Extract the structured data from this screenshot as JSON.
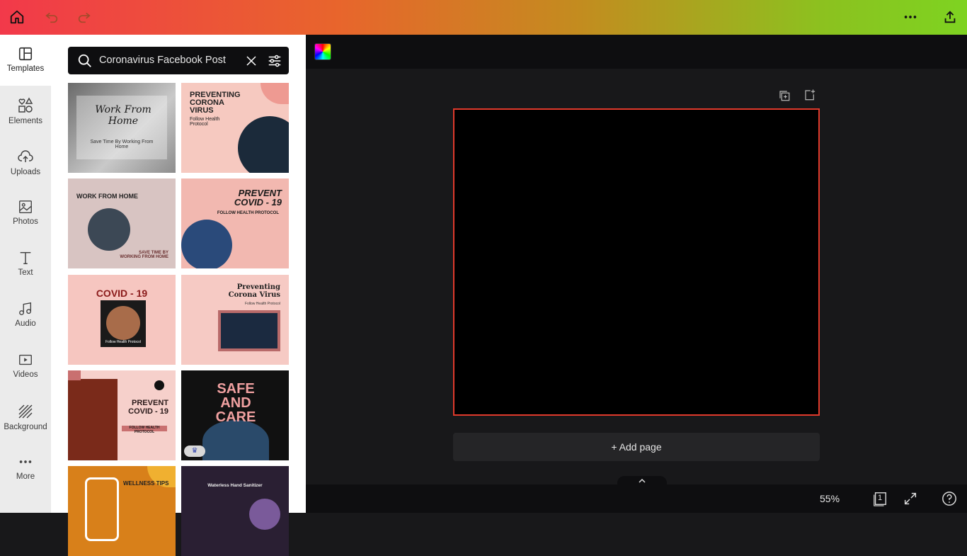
{
  "topbar": {
    "home_icon": "home-icon",
    "undo_icon": "undo-icon",
    "redo_icon": "redo-icon",
    "more_icon": "more-horizontal-icon",
    "share_icon": "share-upload-icon"
  },
  "sidebar": {
    "items": [
      {
        "label": "Templates",
        "icon": "templates-icon"
      },
      {
        "label": "Elements",
        "icon": "elements-icon"
      },
      {
        "label": "Uploads",
        "icon": "upload-cloud-icon"
      },
      {
        "label": "Photos",
        "icon": "photos-icon"
      },
      {
        "label": "Text",
        "icon": "text-icon"
      },
      {
        "label": "Audio",
        "icon": "audio-icon"
      },
      {
        "label": "Videos",
        "icon": "videos-icon"
      },
      {
        "label": "Background",
        "icon": "background-icon"
      },
      {
        "label": "More",
        "icon": "more-icon"
      }
    ]
  },
  "search": {
    "value": "Coronavirus Facebook Post"
  },
  "templates": [
    {
      "title": "Work From Home",
      "sub": "Save Time By Working From Home"
    },
    {
      "title": "PREVENTING CORONA VIRUS",
      "sub": "Follow Health Protocol"
    },
    {
      "title": "WORK FROM HOME",
      "sub": "SAVE TIME BY WORKING FROM HOME"
    },
    {
      "title": "PREVENT COVID - 19",
      "sub": "FOLLOW HEALTH PROTOCOL"
    },
    {
      "title": "COVID - 19",
      "sub": "Follow Health Protocol"
    },
    {
      "title": "Preventing Corona Virus",
      "sub": "Follow Health Protocol"
    },
    {
      "title": "PREVENT COVID - 19",
      "sub": "FOLLOW HEALTH PROTOCOL"
    },
    {
      "title": "SAFE AND CARE",
      "sub": ""
    },
    {
      "title": "WELLNESS TIPS",
      "sub": ""
    },
    {
      "title": "Waterless Hand Sanitizer",
      "sub": ""
    }
  ],
  "canvas": {
    "add_page_label": "+ Add page",
    "zoom_label": "55%",
    "page_count": "1"
  },
  "colors": {
    "accent_border": "#e03a2b",
    "canvas_bg": "#18181a"
  }
}
